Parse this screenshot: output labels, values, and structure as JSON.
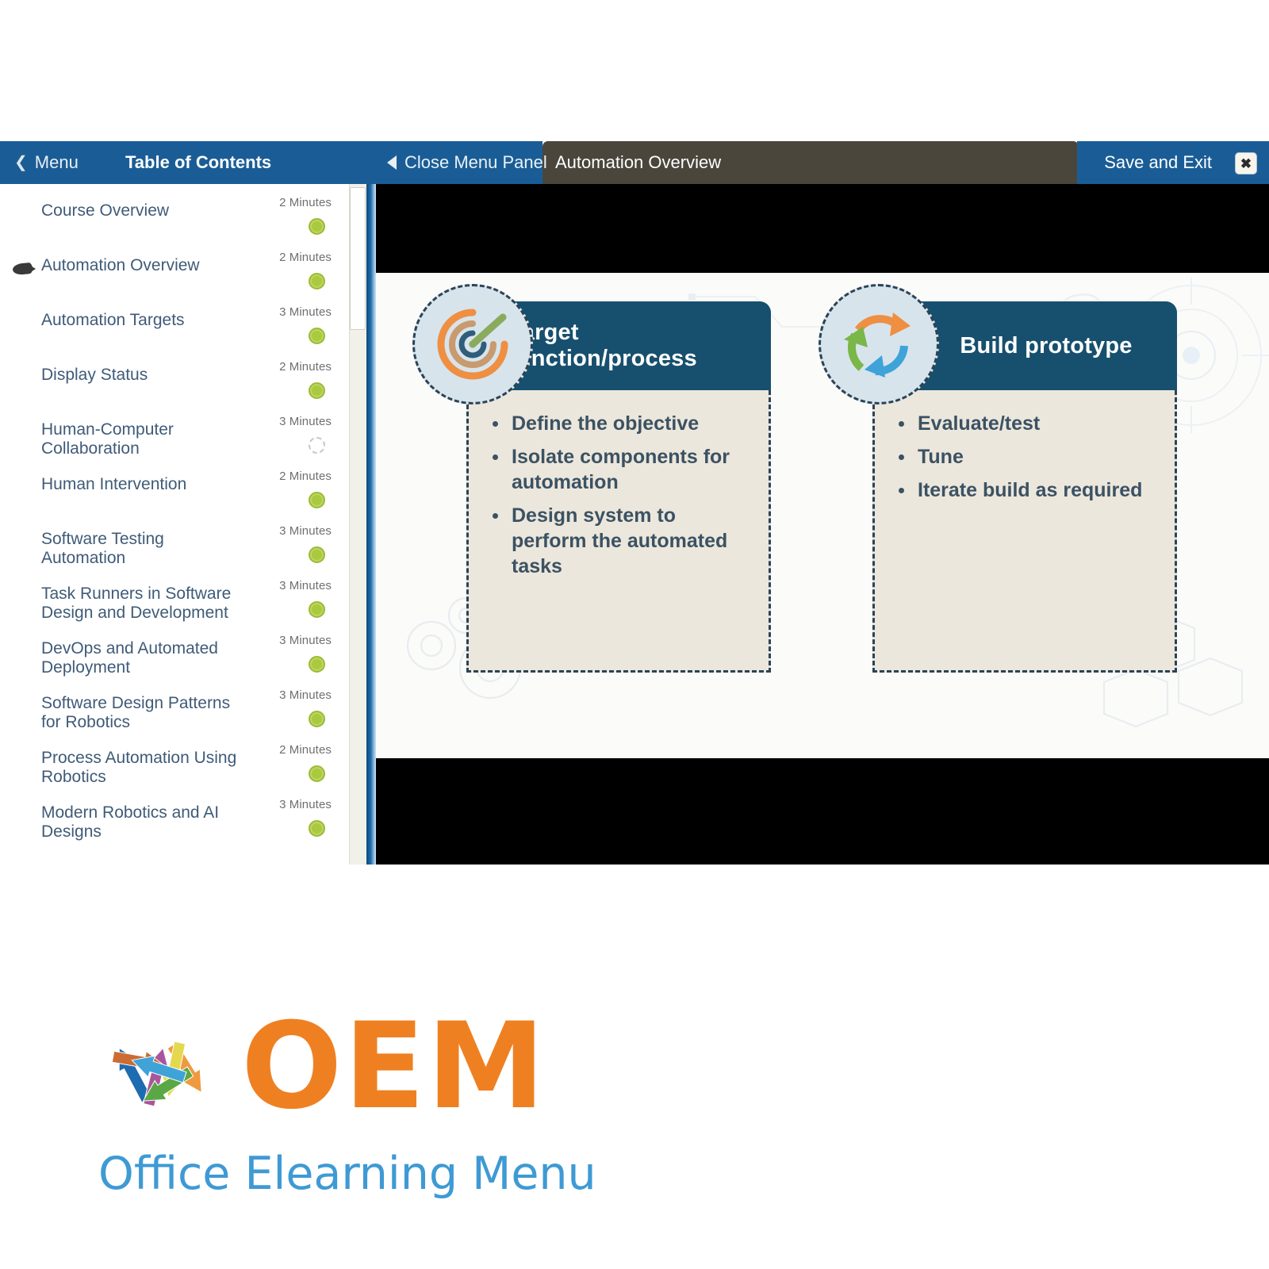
{
  "header": {
    "menu_label": "Menu",
    "menu_chevron_icon": "chevron-left-icon",
    "toc_label": "Table of Contents",
    "close_panel_label": "Close Menu Panel",
    "close_panel_icon": "triangle-left-icon",
    "slide_title": "Automation Overview",
    "save_exit_label": "Save and Exit",
    "close_icon": "close-x-icon",
    "blue": "#1a5d96",
    "dark": "#4a463c"
  },
  "sidebar": {
    "items": [
      {
        "label": "Course Overview",
        "minutes": "2 Minutes",
        "status": "done",
        "current": false
      },
      {
        "label": "Automation Overview",
        "minutes": "2 Minutes",
        "status": "done",
        "current": true
      },
      {
        "label": "Automation Targets",
        "minutes": "3 Minutes",
        "status": "done",
        "current": false
      },
      {
        "label": "Display Status",
        "minutes": "2 Minutes",
        "status": "done",
        "current": false
      },
      {
        "label": "Human-Computer Collaboration",
        "minutes": "3 Minutes",
        "status": "pending",
        "current": false
      },
      {
        "label": "Human Intervention",
        "minutes": "2 Minutes",
        "status": "done",
        "current": false
      },
      {
        "label": "Software Testing Automation",
        "minutes": "3 Minutes",
        "status": "done",
        "current": false
      },
      {
        "label": "Task Runners in Software Design and Development",
        "minutes": "3 Minutes",
        "status": "done",
        "current": false
      },
      {
        "label": "DevOps and Automated Deployment",
        "minutes": "3 Minutes",
        "status": "done",
        "current": false
      },
      {
        "label": "Software Design Patterns for Robotics",
        "minutes": "3 Minutes",
        "status": "done",
        "current": false
      },
      {
        "label": "Process Automation Using Robotics",
        "minutes": "2 Minutes",
        "status": "done",
        "current": false
      },
      {
        "label": "Modern Robotics and AI Designs",
        "minutes": "3 Minutes",
        "status": "done",
        "current": false
      }
    ],
    "dot_done_color": "#aac93f",
    "link_color": "#3f5b78"
  },
  "slide": {
    "cards": [
      {
        "title": "Target function/process",
        "icon": "target-bullseye-arrow-icon",
        "bullets": [
          "Define the objective",
          "Isolate components for automation",
          "Design system to perform the automated tasks"
        ]
      },
      {
        "title": "Build prototype",
        "icon": "circular-arrows-refresh-icon",
        "bullets": [
          "Evaluate/test",
          "Tune",
          "Iterate build as required"
        ]
      }
    ],
    "header_color": "#17506e",
    "body_color": "#ece7dc",
    "badge_color": "#d7e4ec",
    "decorations": [
      "cloud-outline-icon",
      "circuit-trace-icon",
      "crosshair-target-icon",
      "gears-icon",
      "hexagon-icon"
    ]
  },
  "logo": {
    "wordmark": "OEM",
    "tagline": "Office Elearning Menu",
    "wordmark_color": "#ef8022",
    "tagline_color": "#3e9ad4",
    "arrow_icon": "arrow-icon",
    "arrow_colors": [
      "#1d6bb0",
      "#a9569c",
      "#cd6b34",
      "#ef9a3e",
      "#e4d94e",
      "#5aa845",
      "#3fa3d8"
    ]
  }
}
